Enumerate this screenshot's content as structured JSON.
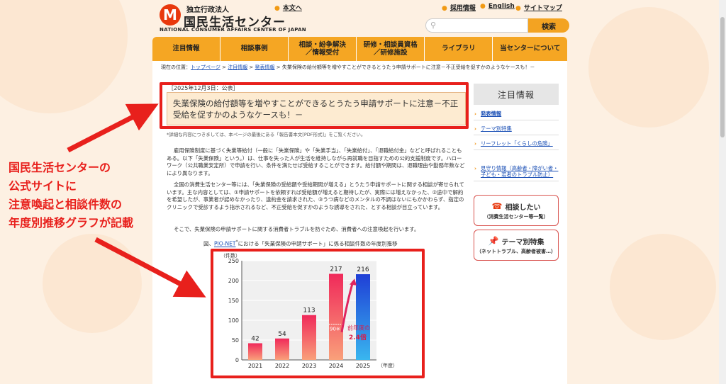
{
  "header": {
    "org_small": "独立行政法人",
    "org_name": "国民生活センター",
    "org_en": "NATIONAL CONSUMER AFFAIRS CENTER OF JAPAN",
    "logo_mark": "M",
    "skip_link": "本文へ",
    "links": [
      "採用情報",
      "English",
      "サイトマップ"
    ],
    "search_placeholder": "",
    "search_button": "検索"
  },
  "nav": {
    "items": [
      "注目情報",
      "相談事例",
      "相談・紛争解決\n／情報受付",
      "研修・相談員資格\n／研修施設",
      "ライブラリ",
      "当センターについて"
    ]
  },
  "breadcrumb": {
    "prefix": "現在の位置：",
    "links": [
      "トップページ",
      "注目情報",
      "発表情報"
    ],
    "sep": " > ",
    "current": "失業保険の給付額等を増やすことができるとうたう申請サポートに注意－不正受給を促すかのようなケースも！－"
  },
  "article": {
    "date": "［2025年12月3日：公表］",
    "title": "失業保険の給付額等を増やすことができるとうたう申請サポートに注意－不正受給を促すかのようなケースも！－",
    "note": "*詳細な内容につきましては、本ページの最後にある「報告書本文[PDF形式]」をご覧ください。",
    "para1": "雇用保険制度に基づく失業等給付（一般に「失業保険」や「失業手当」、「失業給付」、「退職給付金」などと呼ばれることもある。以下「失業保険」という。）は、仕事を失った人が生活を維持しながら再就職を目指すための公的支援制度です。ハローワーク（公共職業安定所）で申請を行い、条件を満たせば受給することができます。給付額や期間は、退職理由や勤務年数などにより異なります。",
    "para2": "全国の消費生活センター等には、「失業保険の受給額や受給期間が増える」とうたう申請サポートに関する相談が寄せられています。主な内容としては、①申請サポートを依頼すれば受給額が増えると期待したが、実際には増えなかった、②途中で解約を希望したが、事業者が認めなかったり、違約金を請求された、③うつ病などのメンタルの不調はないにもかかわらず、指定のクリニックで受診するよう指示されるなど、不正受給を促すかのような誘導をされた、とする相談が目立っています。",
    "para3": "そこで、失業保険の申請サポートに関する消費者トラブルを防ぐため、消費者への注意喚起を行います。",
    "fig_prefix": "図、",
    "fig_link": "PIO-NET",
    "fig_suffix": "における「失業保険の申請サポート」に係る相談件数の年度別推移"
  },
  "chart_data": {
    "type": "bar",
    "categories": [
      "2021",
      "2022",
      "2023",
      "2024",
      "2025"
    ],
    "values": [
      42,
      54,
      113,
      217,
      216
    ],
    "ylabel": "（件数）",
    "xlabel": "（年度）",
    "ylim": [
      0,
      250
    ],
    "yticks": [
      0,
      50,
      100,
      150,
      200,
      250
    ],
    "grid": true,
    "sub_value_2024": 90,
    "sub_label": "90※",
    "annotation": "前年度の\n2.4倍",
    "colors": {
      "pink": "#f4506a",
      "blue": "#2f6de0"
    }
  },
  "sidebar": {
    "heading": "注目情報",
    "items": [
      "発表情報",
      "テーマ別特集",
      "リーフレット「くらしの危険」",
      "見守り情報（高齢者・障がい者・子ども・若者のトラブル防止）"
    ],
    "btn1_main": "相談したい",
    "btn1_sub": "（消費生活センター等一覧）",
    "btn2_main": "テーマ別特集",
    "btn2_sub": "（ネットトラブル、高齢者被害…）"
  },
  "annotation": {
    "lines": [
      "国民生活センターの",
      "公式サイトに",
      "注意喚起と相談件数の",
      "年度別推移グラフが記載"
    ]
  },
  "colors": {
    "accent": "#f5a623",
    "red": "#e8201c",
    "link": "#1a4fb5"
  }
}
